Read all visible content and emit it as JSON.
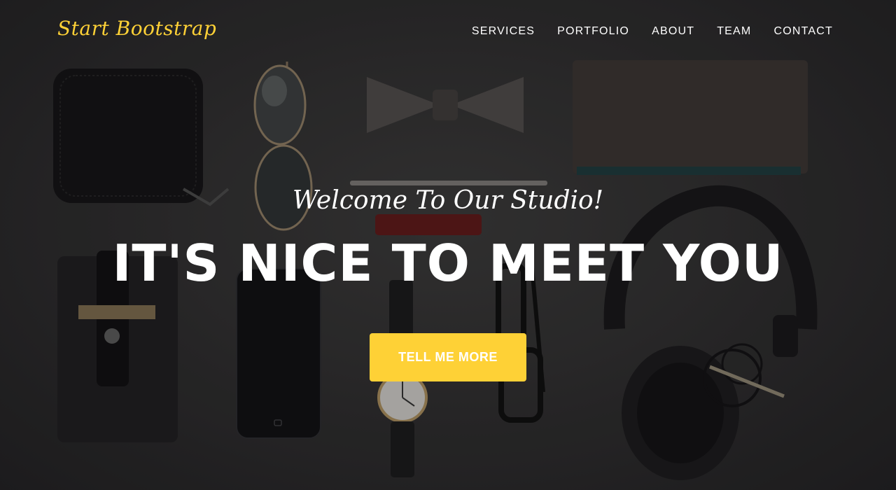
{
  "brand": {
    "label": "Start Bootstrap",
    "color": "#fed136"
  },
  "nav": {
    "items": [
      {
        "label": "SERVICES"
      },
      {
        "label": "PORTFOLIO"
      },
      {
        "label": "ABOUT"
      },
      {
        "label": "TEAM"
      },
      {
        "label": "CONTACT"
      }
    ]
  },
  "hero": {
    "subheading": "Welcome To Our Studio!",
    "heading": "IT'S NICE TO MEET YOU",
    "cta_label": "TELL ME MORE",
    "cta_color": "#fed136",
    "background_image": "flat-lay-accessories-photo"
  }
}
